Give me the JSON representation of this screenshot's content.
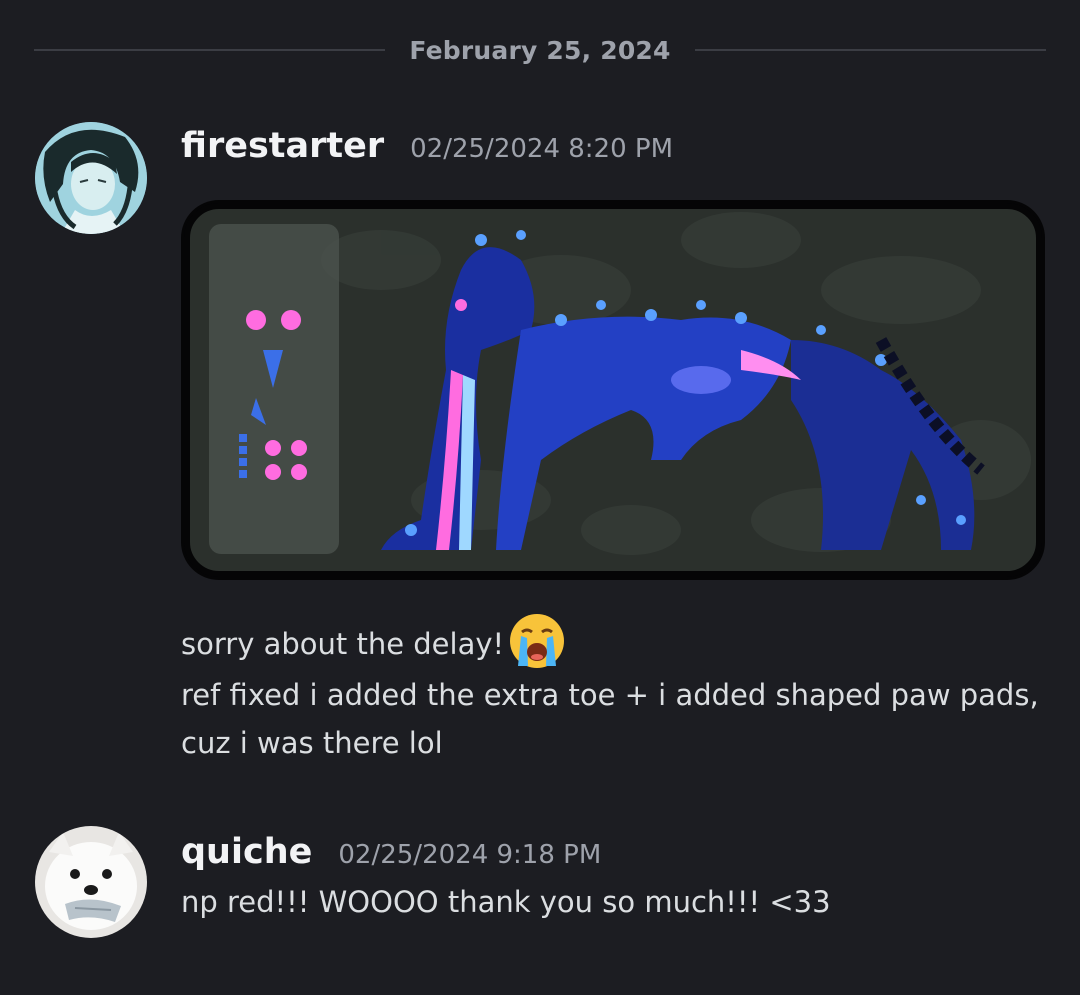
{
  "divider": {
    "date": "February 25, 2024"
  },
  "messages": [
    {
      "username": "firestarter",
      "timestamp": "02/25/2024 8:20 PM",
      "avatar_icon": "anime-portrait-avatar",
      "attachment_icon": "character-reference-sheet-image",
      "lines": [
        "sorry about the delay!",
        "ref fixed i added the extra toe + i added shaped paw pads,",
        "cuz i was there lol"
      ],
      "emoji_icon": "loudly-crying-face-emoji"
    },
    {
      "username": "quiche",
      "timestamp": "02/25/2024 9:18 PM",
      "avatar_icon": "white-dog-avatar",
      "lines": [
        "np red!!! WOOOO thank you so much!!! <33"
      ]
    }
  ],
  "colors": {
    "background": "#1c1d22",
    "username": "#f2f3f5",
    "muted": "#9ea2ab",
    "text": "#dbdee1",
    "accent_blue": "#2b4bd8",
    "accent_pink": "#ff4fd8"
  }
}
